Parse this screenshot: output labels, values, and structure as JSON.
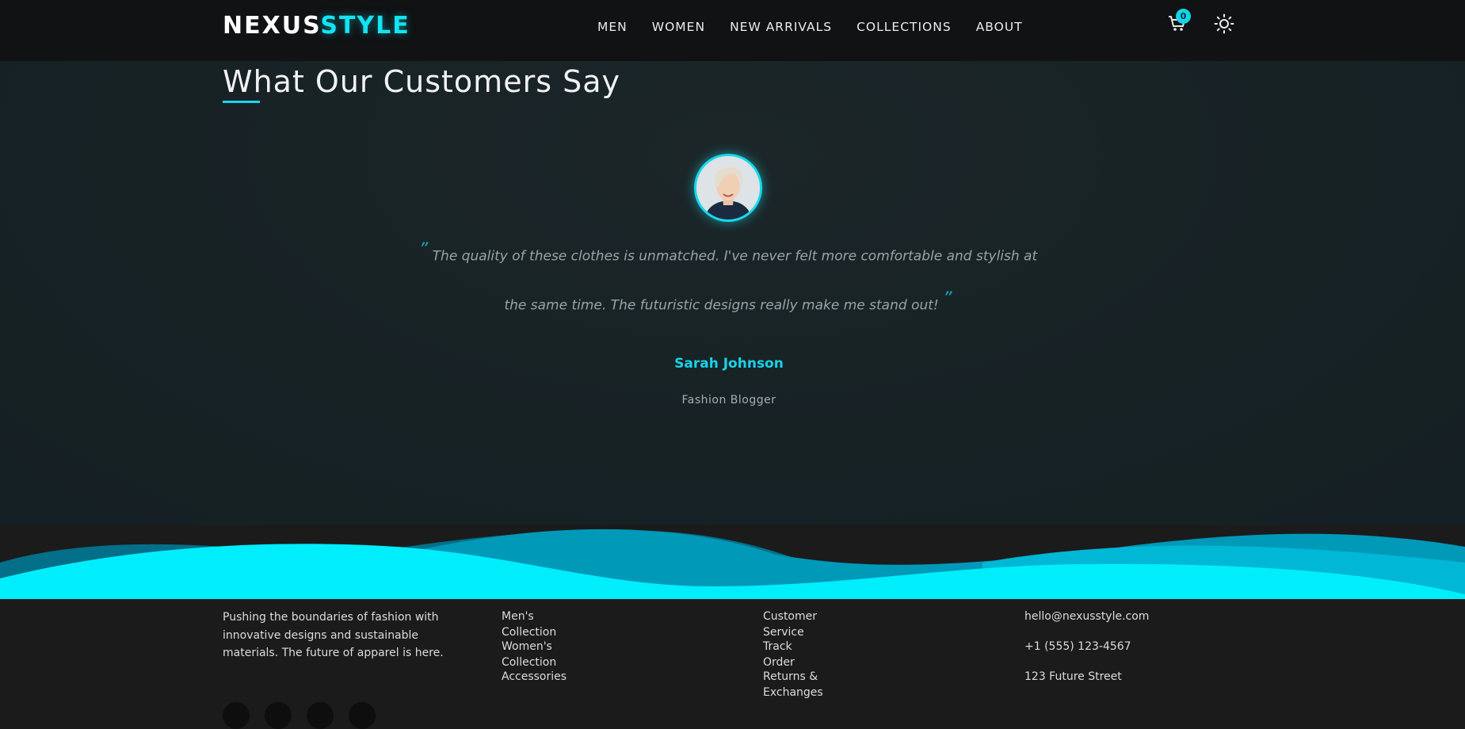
{
  "brand": {
    "part1": "NEXUS",
    "part2": "STYLE",
    "accent": "#14e3f2"
  },
  "nav": [
    "MEN",
    "WOMEN",
    "NEW ARRIVALS",
    "COLLECTIONS",
    "ABOUT"
  ],
  "cart": {
    "count": "0",
    "icon": "cart-icon"
  },
  "theme_toggle": {
    "icon": "sun-icon"
  },
  "testimonials": {
    "title": "What Our Customers Say",
    "quote": "The quality of these clothes is unmatched. I've never felt more comfortable and stylish at the same time. The futuristic designs really make me stand out!",
    "open_mark": "”",
    "close_mark": "”",
    "author": "Sarah Johnson",
    "role": "Fashion Blogger"
  },
  "footer": {
    "about_text": "Pushing the boundaries of fashion with innovative designs and sustainable materials. The future of apparel is here.",
    "shop_links": [
      "Men's Collection",
      "Women's Collection",
      "Accessories"
    ],
    "help_links": [
      "Customer Service",
      "Track Order",
      "Returns & Exchanges"
    ],
    "contact": [
      "hello@nexusstyle.com",
      "+1 (555) 123-4567",
      "123 Future Street"
    ]
  }
}
